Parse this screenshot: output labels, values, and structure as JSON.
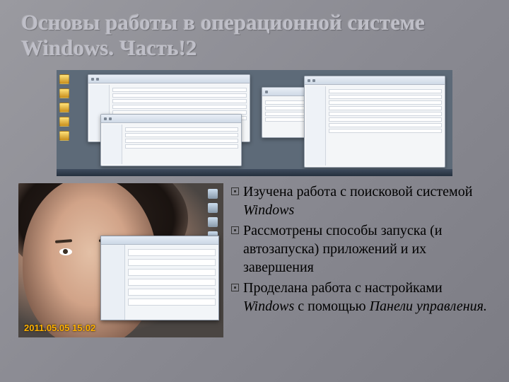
{
  "title": "Основы работы в операционной системе Windows. Часть!2",
  "timestamp": "2011.05.05 15:02",
  "bullets": [
    {
      "pre": "Изучена работа с поисковой системой ",
      "em": "Windows",
      "post": ""
    },
    {
      "pre": "Рассмотрены способы запуска (и автозапуска) приложений и их завершения",
      "em": "",
      "post": ""
    },
    {
      "pre": "Проделана работа с настройками ",
      "em": "Windows",
      "post": " с помощью ",
      "em2": "Панели управления.",
      "post2": ""
    }
  ]
}
